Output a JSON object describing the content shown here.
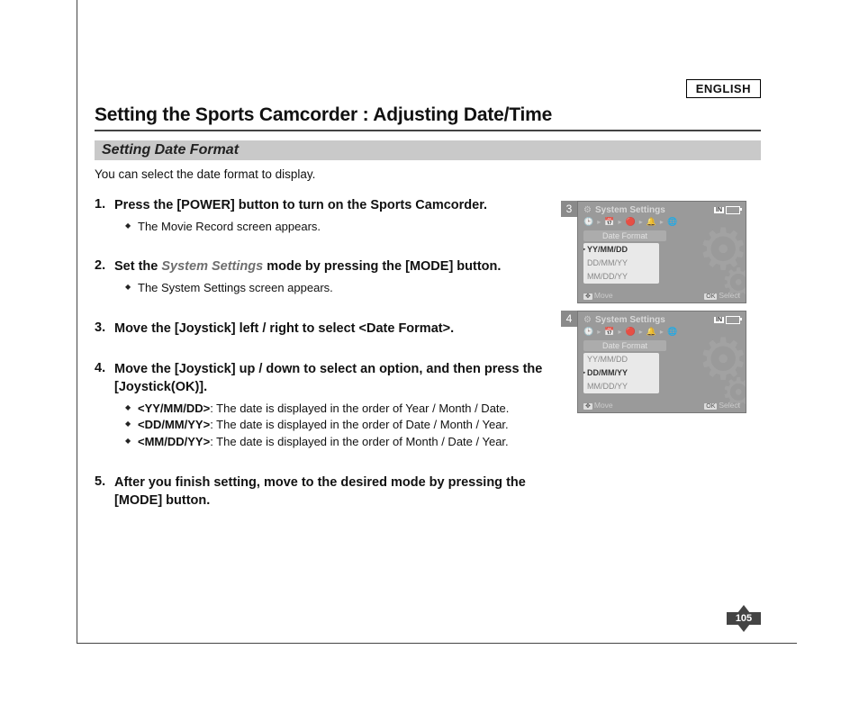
{
  "language_badge": "ENGLISH",
  "page_title": "Setting the Sports Camcorder : Adjusting Date/Time",
  "subsection_title": "Setting Date Format",
  "intro_text": "You can select the date format to display.",
  "steps": [
    {
      "head_plain": "Press the [POWER] button to turn on the Sports Camcorder.",
      "sub": [
        "The Movie Record screen appears."
      ]
    },
    {
      "head_before": "Set the ",
      "head_ital": "System Settings",
      "head_after": " mode by pressing the [MODE] button.",
      "sub": [
        "The System Settings screen appears."
      ]
    },
    {
      "head_plain": "Move the [Joystick] left / right to select <Date Format>.",
      "sub": []
    },
    {
      "head_plain": "Move the [Joystick] up / down to select an option, and then press the [Joystick(OK)].",
      "sub_opts": [
        {
          "opt": "<YY/MM/DD>",
          "desc": ": The date is displayed in the order of Year / Month / Date."
        },
        {
          "opt": "<DD/MM/YY>",
          "desc": ": The date is displayed in the order of Date / Month / Year."
        },
        {
          "opt": "<MM/DD/YY>",
          "desc": ": The date is displayed in the order of Month / Date / Year."
        }
      ]
    },
    {
      "head_plain": "After you finish setting, move to the desired mode by pressing the [MODE] button.",
      "sub": []
    }
  ],
  "figures": [
    {
      "num": "3",
      "screen_title": "System Settings",
      "mem_label": "IN",
      "menu_label": "Date Format",
      "options": [
        "YY/MM/DD",
        "DD/MM/YY",
        "MM/DD/YY"
      ],
      "selected_index": 0,
      "hint_left": "Move",
      "hint_right_key": "OK",
      "hint_right": "Select"
    },
    {
      "num": "4",
      "screen_title": "System Settings",
      "mem_label": "IN",
      "menu_label": "Date Format",
      "options": [
        "YY/MM/DD",
        "DD/MM/YY",
        "MM/DD/YY"
      ],
      "selected_index": 1,
      "hint_left": "Move",
      "hint_right_key": "OK",
      "hint_right": "Select"
    }
  ],
  "page_number": "105"
}
